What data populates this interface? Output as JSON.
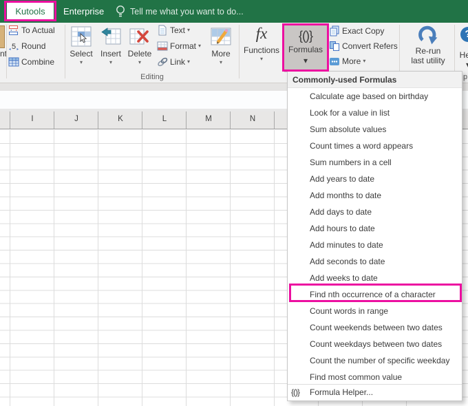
{
  "colors": {
    "excel_green": "#217346",
    "highlight_magenta": "#ec0fa0",
    "ribbon_bg": "#f1f1f1",
    "pressed_button_bg": "#c9c6c4",
    "icon_blue": "#4a7ebb",
    "help_blue": "#2e74b5"
  },
  "tabbar": {
    "active_tab": "Kutools",
    "second_tab": "Enterprise",
    "tellme_text": "Tell me what you want to do..."
  },
  "ribbon": {
    "left_partial_label": "nt",
    "group1": [
      "To Actual",
      "Round",
      "Combine"
    ],
    "big_buttons": [
      "Select",
      "Insert",
      "Delete"
    ],
    "group2": [
      "Text",
      "Format",
      "Link"
    ],
    "more_label": "More",
    "editing_group_label": "Editing",
    "functions_label": "Functions",
    "functions_icon_glyph": "fx",
    "formulas_label": "Formulas",
    "formulas_icon_glyph": "{()}",
    "group3": [
      "Exact Copy",
      "Convert Refers",
      "More"
    ],
    "rerun_line1": "Re-run",
    "rerun_line2": "last utility",
    "help_label": "Help",
    "help_icon_glyph": "?",
    "right_partial_label": "p",
    "caret": "▾"
  },
  "grid": {
    "columns": [
      "I",
      "J",
      "K",
      "L",
      "M",
      "N"
    ]
  },
  "menu": {
    "header": "Commonly-used Formulas",
    "items": [
      "Calculate age based on birthday",
      "Look for a value in list",
      "Sum absolute values",
      "Count times a word appears",
      "Sum numbers in a cell",
      "Add years to date",
      "Add months to date",
      "Add days to date",
      "Add hours to date",
      "Add minutes to date",
      "Add seconds to date",
      "Add weeks to date",
      "Find nth occurrence of a character",
      "Count words in range",
      "Count weekends between two dates",
      "Count weekdays between two dates",
      "Count the number of specific weekday",
      "Find most common value"
    ],
    "highlighted_item": "Find nth occurrence of a character",
    "footer_icon_glyph": "{()}",
    "footer_label": "Formula Helper..."
  }
}
